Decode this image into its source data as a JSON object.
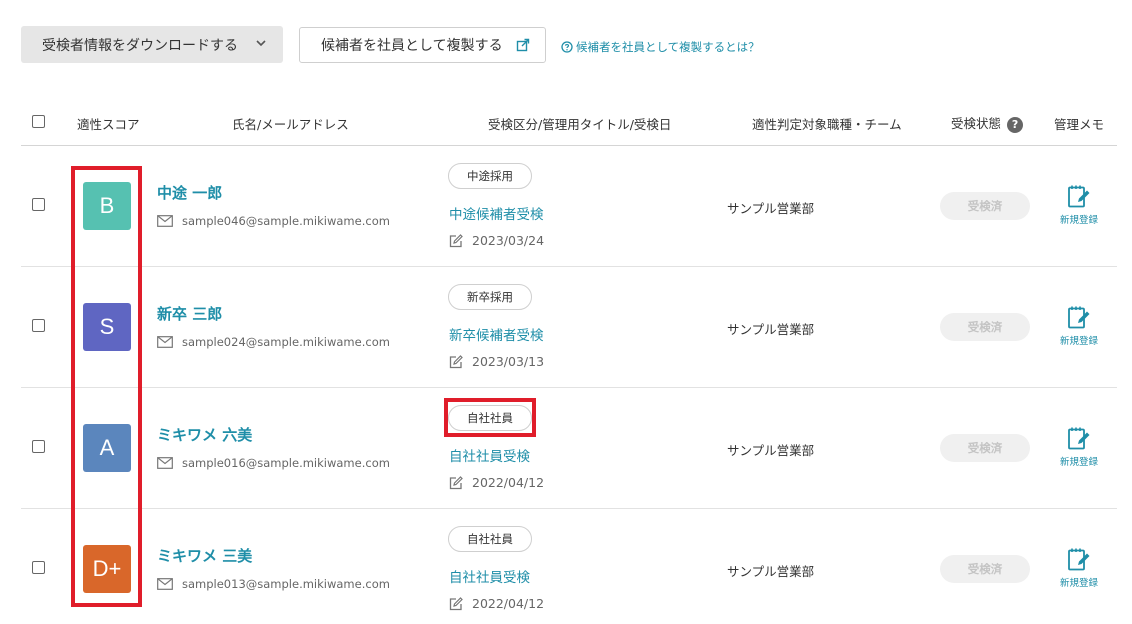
{
  "toolbar": {
    "download_label": "受検者情報をダウンロードする",
    "duplicate_label": "候補者を社員として複製する",
    "help_link": "候補者を社員として複製するとは？"
  },
  "table": {
    "headers": {
      "score": "適性スコア",
      "name": "氏名/メールアドレス",
      "exam": "受検区分/管理用タイトル/受検日",
      "team": "適性判定対象職種・チーム",
      "status": "受検状態",
      "memo": "管理メモ"
    },
    "rows": [
      {
        "grade": "B",
        "grade_color": "#56c1b1",
        "name": "中途 一郎",
        "email": "sample046@sample.mikiwame.com",
        "category": "中途採用",
        "title": "中途候補者受検",
        "date": "2023/03/24",
        "team": "サンプル営業部",
        "status": "受検済",
        "memo": "新規登録"
      },
      {
        "grade": "S",
        "grade_color": "#5f66c2",
        "name": "新卒 三郎",
        "email": "sample024@sample.mikiwame.com",
        "category": "新卒採用",
        "title": "新卒候補者受検",
        "date": "2023/03/13",
        "team": "サンプル営業部",
        "status": "受検済",
        "memo": "新規登録"
      },
      {
        "grade": "A",
        "grade_color": "#5b86bd",
        "name": "ミキワメ 六美",
        "email": "sample016@sample.mikiwame.com",
        "category": "自社社員",
        "title": "自社社員受検",
        "date": "2022/04/12",
        "team": "サンプル営業部",
        "status": "受検済",
        "memo": "新規登録"
      },
      {
        "grade": "D+",
        "grade_color": "#d9672a",
        "name": "ミキワメ 三美",
        "email": "sample013@sample.mikiwame.com",
        "category": "自社社員",
        "title": "自社社員受検",
        "date": "2022/04/12",
        "team": "サンプル営業部",
        "status": "受検済",
        "memo": "新規登録"
      }
    ]
  }
}
